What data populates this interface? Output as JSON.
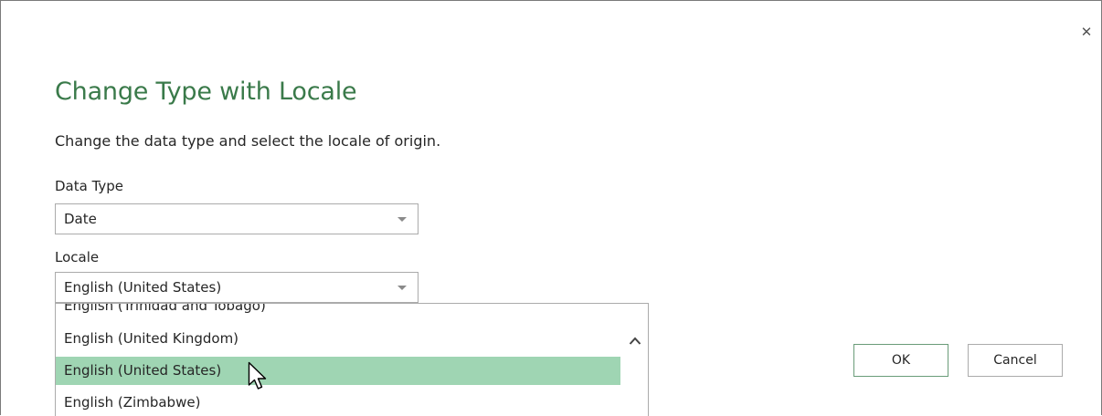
{
  "dialog": {
    "close_label": "✕",
    "title": "Change Type with Locale",
    "subtitle": "Change the data type and select the locale of origin."
  },
  "data_type": {
    "label": "Data Type",
    "value": "Date"
  },
  "locale": {
    "label": "Locale",
    "value": "English (United States)",
    "options": [
      "English (Trinidad and Tobago)",
      "English (United Kingdom)",
      "English (United States)",
      "English (Zimbabwe)"
    ],
    "highlighted_option": "English (United States)"
  },
  "buttons": {
    "ok": "OK",
    "cancel": "Cancel"
  },
  "colors": {
    "title": "#3a7a4a",
    "highlight": "#9fd5b3"
  },
  "icons": {
    "close": "close-icon",
    "dropdown": "chevron-down-icon",
    "scroll_up": "chevron-up-icon",
    "pointer": "mouse-pointer-icon"
  }
}
